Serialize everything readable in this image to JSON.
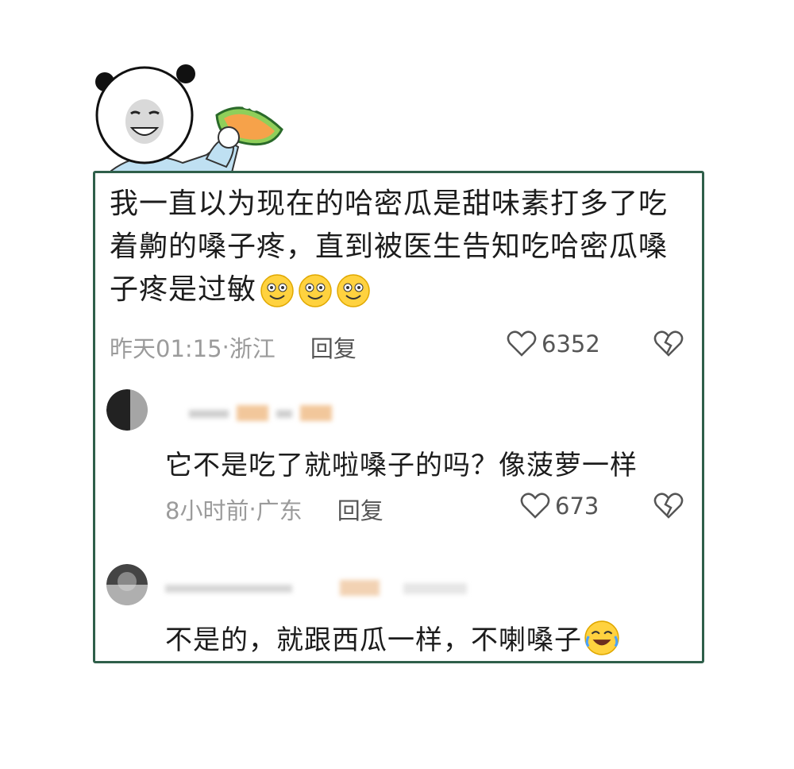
{
  "post": {
    "text": "我一直以为现在的哈密瓜是甜味素打多了吃着齁的嗓子疼，直到被医生告知吃哈密瓜嗓子疼是过敏",
    "time": "昨天01:15",
    "separator": " · ",
    "location": "浙江",
    "reply_label": "回复",
    "likes": "6352"
  },
  "replies": [
    {
      "text": "它不是吃了就啦嗓子的吗？像菠萝一样",
      "time": "8小时前",
      "separator": " · ",
      "location": "广东",
      "reply_label": "回复",
      "likes": "673"
    },
    {
      "text": "不是的，就跟西瓜一样，不喇嗓子"
    }
  ],
  "icons": {
    "like": "heart-outline-icon",
    "dislike": "broken-heart-icon",
    "smile": "smile-emoji-icon",
    "laugh_cry": "laugh-cry-emoji-icon"
  },
  "colors": {
    "border": "#2f5f4a",
    "meta": "#9b9b9b",
    "text": "#1c1c1c"
  }
}
